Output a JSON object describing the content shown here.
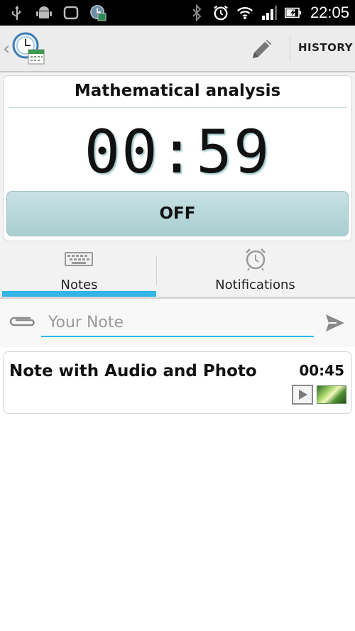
{
  "status_bar": {
    "time": "22:05",
    "left_icons": [
      "usb-icon",
      "android-icon",
      "watch-icon",
      "clock-badge-icon"
    ],
    "right_icons": [
      "bluetooth-icon",
      "alarm-icon",
      "wifi-icon",
      "signal-icon",
      "battery-charging-icon"
    ]
  },
  "action_bar": {
    "up_glyph": "‹",
    "logo_icon": "clock-calendar-icon",
    "edit_icon": "pencil-icon",
    "history_label": "HISTORY"
  },
  "timer_card": {
    "title": "Mathematical analysis",
    "time": "00:59",
    "toggle_label": "OFF"
  },
  "tabs": [
    {
      "label": "Notes",
      "icon": "keyboard-icon",
      "selected": true
    },
    {
      "label": "Notifications",
      "icon": "alarm-clock-icon",
      "selected": false
    }
  ],
  "note_input": {
    "placeholder": "Your Note",
    "value": "",
    "attach_icon": "paperclip-icon",
    "send_icon": "send-icon"
  },
  "notes": [
    {
      "title": "Note with Audio and Photo",
      "time": "00:45",
      "attachments": [
        "play-icon",
        "photo-thumbnail"
      ]
    }
  ],
  "colors": {
    "accent": "#33b5e5",
    "toggle_bg": "#b8d8da",
    "status_bar": "#000000"
  }
}
